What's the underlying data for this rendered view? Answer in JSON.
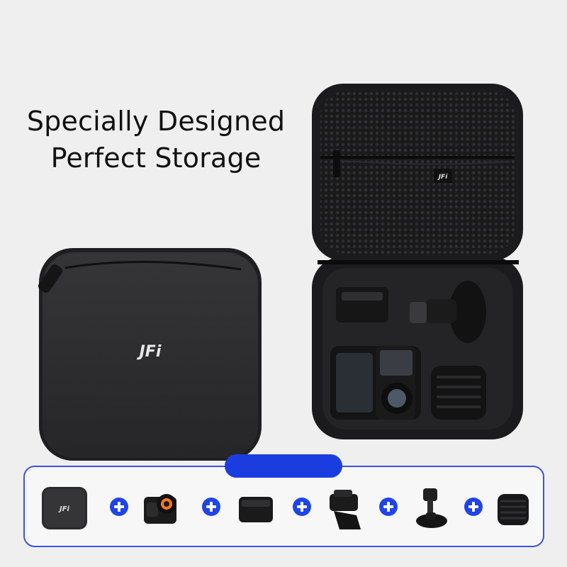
{
  "headline": {
    "line1": "Specially Designed",
    "line2": "Perfect Storage"
  },
  "brand": {
    "logo_text": "JFi"
  },
  "colors": {
    "background": "#efefef",
    "accent_blue": "#1b3de0",
    "case_black": "#2b2b2d"
  },
  "included_items": [
    {
      "icon": "storage-case-icon"
    },
    {
      "icon": "action-camera-icon"
    },
    {
      "icon": "battery-module-icon"
    },
    {
      "icon": "quick-release-mount-icon"
    },
    {
      "icon": "suction-cup-mount-icon"
    },
    {
      "icon": "lens-cover-icon"
    }
  ]
}
